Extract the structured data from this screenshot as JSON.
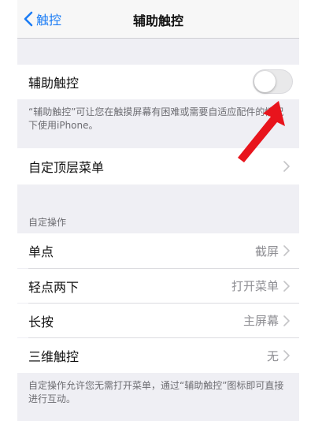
{
  "nav": {
    "back_label": "触控",
    "title": "辅助触控"
  },
  "assistive_touch": {
    "label": "辅助触控",
    "enabled": false,
    "footnote": "“辅助触控”可让您在触摸屏幕有困难或需要自适应配件的情况下使用iPhone。"
  },
  "customize_menu": {
    "label": "自定顶层菜单"
  },
  "custom_actions": {
    "header": "自定操作",
    "rows": [
      {
        "label": "单点",
        "value": "截屏"
      },
      {
        "label": "轻点两下",
        "value": "打开菜单"
      },
      {
        "label": "长按",
        "value": "主屏幕"
      },
      {
        "label": "三维触控",
        "value": "无"
      }
    ],
    "footnote": "自定操作允许您无需打开菜单，通过“辅助触控”图标即可直接进行互动。"
  },
  "colors": {
    "accent": "#1a7cf5",
    "annotation_arrow": "#e8141c",
    "grouped_background": "#efeff4"
  }
}
